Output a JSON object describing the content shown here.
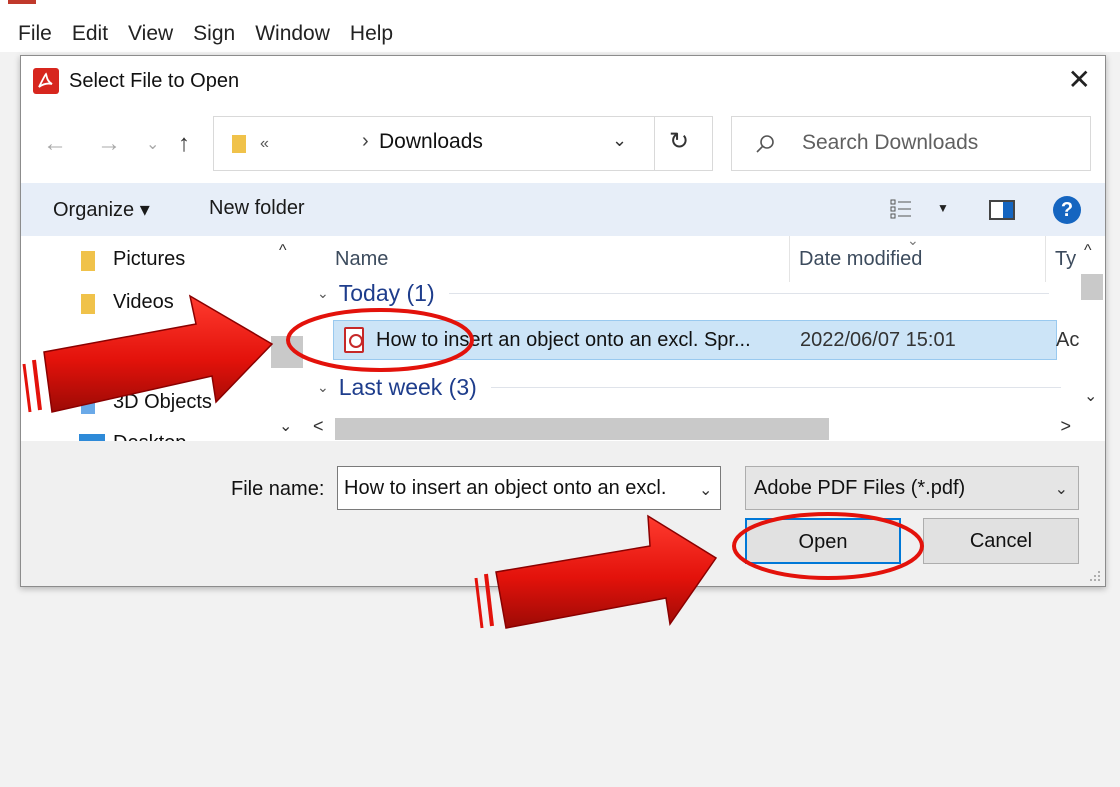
{
  "app": {
    "menu": [
      "File",
      "Edit",
      "View",
      "Sign",
      "Window",
      "Help"
    ]
  },
  "dialog": {
    "title": "Select File to Open",
    "close_glyph": "✕",
    "nav": {
      "back": "←",
      "forward": "→",
      "recent": "⌄",
      "up": "↑",
      "address_prefix": "«",
      "address_separator": "›",
      "address_path": "Downloads",
      "address_dropdown": "⌄",
      "refresh": "↻",
      "search_placeholder": "Search Downloads"
    },
    "toolbar": {
      "organize": "Organize ▾",
      "new_folder": "New folder",
      "view_dropdown": "▼",
      "help": "?"
    },
    "navpane": {
      "items": [
        "Pictures",
        "Videos",
        "3D Objects",
        "Desktop"
      ],
      "scroll_up": "^",
      "scroll_down": "⌄"
    },
    "filelist": {
      "columns": {
        "name": "Name",
        "date": "Date modified",
        "type": "Ty"
      },
      "sort_glyph": "⌄",
      "groups": [
        {
          "label": "Today (1)"
        },
        {
          "label": "Last week (3)"
        }
      ],
      "group_chevron": "⌄",
      "selected_file": {
        "name": "How to insert an object onto an excl. Spr...",
        "date": "2022/06/07 15:01",
        "type": "Ac"
      },
      "scroll_up": "^",
      "scroll_down": "⌄",
      "scroll_left": "<",
      "scroll_right": ">"
    },
    "footer": {
      "file_name_label": "File name:",
      "file_name_value": "How to insert an object onto an excl.",
      "file_name_dropdown": "⌄",
      "file_type": "Adobe PDF Files (*.pdf)",
      "file_type_dropdown": "⌄",
      "open": "Open",
      "cancel": "Cancel"
    }
  },
  "colors": {
    "accent": "#0078d7",
    "selection": "#cce4f7",
    "annotation": "#e3120b",
    "group_header": "#1e3d8c"
  }
}
